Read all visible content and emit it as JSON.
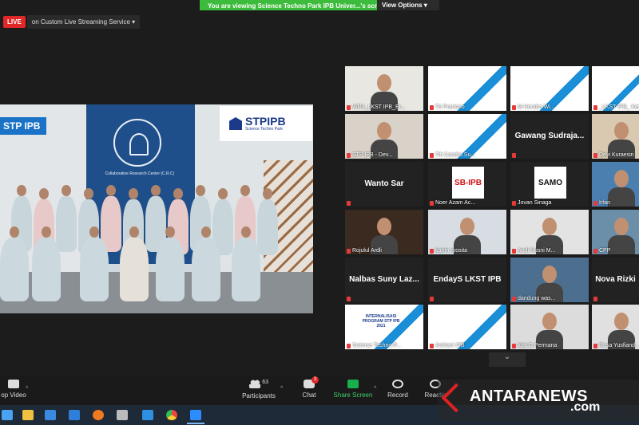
{
  "banner": {
    "viewing_text": "You are viewing Science Techno Park IPB Univer...'s screen",
    "view_options": "View Options ▾"
  },
  "live": {
    "badge": "LIVE",
    "service": "on Custom Live Streaming Service ▾"
  },
  "shared_screen": {
    "corner_label": "STP IPB",
    "logo_text": "STPIPB",
    "logo_sub": "Science Techno Park",
    "crc_text": "Collaborative Research Center (C.R.C)"
  },
  "tiles": [
    {
      "label": "WR4_LKST IPB_Er...",
      "kind": "face",
      "bg": "#e9e7e2",
      "active": true
    },
    {
      "label": "Tri Prartono",
      "kind": "poster"
    },
    {
      "label": "M Hendra Wi...",
      "kind": "poster"
    },
    {
      "label": "_LKST IPB_ Ket...",
      "kind": "poster"
    },
    {
      "label": "STP IPB - Dev...",
      "kind": "face",
      "bg": "#d9d2c8"
    },
    {
      "label": "Titi Candra Su...",
      "kind": "poster"
    },
    {
      "label": "",
      "name": "Gawang Sudraja...",
      "kind": "name"
    },
    {
      "label": "Devi Kuraesin",
      "kind": "face",
      "bg": "#d8c9b0"
    },
    {
      "label": "",
      "name": "Wanto Sar",
      "kind": "name"
    },
    {
      "label": "Noer Azam Ac...",
      "kind": "logo",
      "logo": "SB-IPB"
    },
    {
      "label": "Jovan Sinaga",
      "kind": "logo",
      "logo": "SAMO"
    },
    {
      "label": "Irfan",
      "kind": "face",
      "bg": "#4a7fb0"
    },
    {
      "label": "Rojulul Ardli",
      "kind": "face",
      "bg": "#3b2a20"
    },
    {
      "label": "katrin roosita",
      "kind": "face",
      "bg": "#d7dde2"
    },
    {
      "label": "Andi Husni M...",
      "kind": "face",
      "bg": "#e3e3e3"
    },
    {
      "label": "CPP",
      "kind": "face",
      "bg": "#6b8fa8"
    },
    {
      "label": "",
      "name": "Nalbas Suny Laz...",
      "kind": "name"
    },
    {
      "label": "",
      "name": "EndayS LKST IPB",
      "kind": "name"
    },
    {
      "label": "dandung was...",
      "kind": "face",
      "bg": "#4c6f8f"
    },
    {
      "label": "",
      "name": "Nova Rizki",
      "kind": "name"
    },
    {
      "label": "Science Techno P...",
      "kind": "poster",
      "poster_text": "INTERNALISASI PROGRAM STP IPB 2021"
    },
    {
      "label": "Astriani IPB",
      "kind": "poster"
    },
    {
      "label": "Idat G Permana",
      "kind": "face",
      "bg": "#dcdcdc"
    },
    {
      "label": "Rosa Yusfiand...",
      "kind": "face",
      "bg": "#e0e0e0"
    }
  ],
  "controls": {
    "stop_video": "op Video",
    "participants_count": "63",
    "participants": "Participants",
    "chat_badge": "3",
    "chat": "Chat",
    "share_screen": "Share Screen",
    "record": "Record",
    "reactions": "Reactio"
  },
  "watermark": {
    "brand": "ANTARANEWS",
    "suffix": ".com"
  },
  "colors": {
    "share_green": "#3dbb3d",
    "live_red": "#e02828",
    "active_outline": "#8ad82a",
    "taskbar": "#1e2a38"
  }
}
